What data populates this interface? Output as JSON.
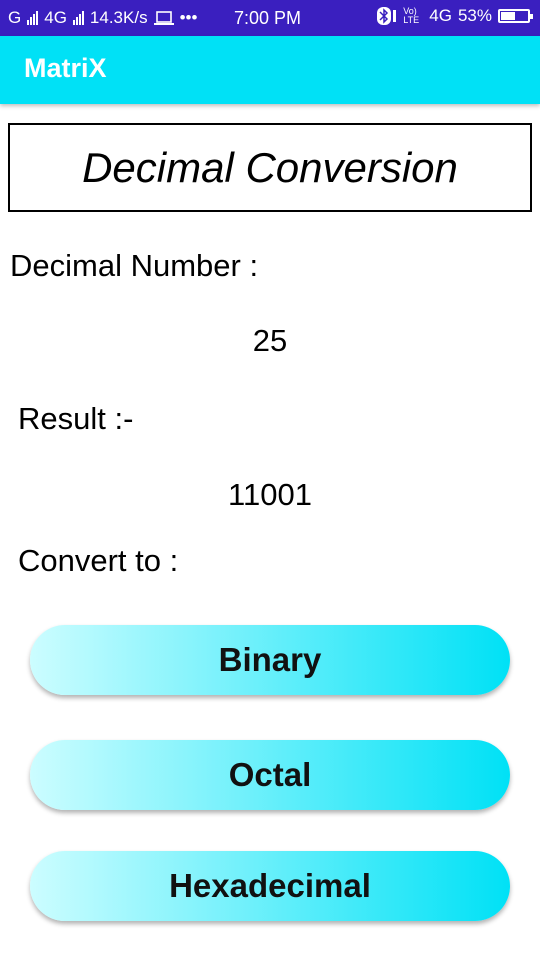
{
  "status_bar": {
    "network_1": "G",
    "network_2": "4G",
    "speed": "14.3K/s",
    "more": "•••",
    "time": "7:00 PM",
    "volte": "Vo) LTE",
    "network_3": "4G",
    "battery": "53%",
    "battery_level": 0.53
  },
  "app_bar": {
    "title": "MatriX"
  },
  "header": {
    "title": "Decimal Conversion"
  },
  "input": {
    "label": "Decimal Number :",
    "value": "25"
  },
  "result": {
    "label": "Result :-",
    "value": "11001"
  },
  "convert": {
    "label": "Convert to :",
    "buttons": [
      "Binary",
      "Octal",
      "Hexadecimal"
    ]
  },
  "colors": {
    "status_bar": "#3a1fbf",
    "accent": "#00e1f6"
  }
}
